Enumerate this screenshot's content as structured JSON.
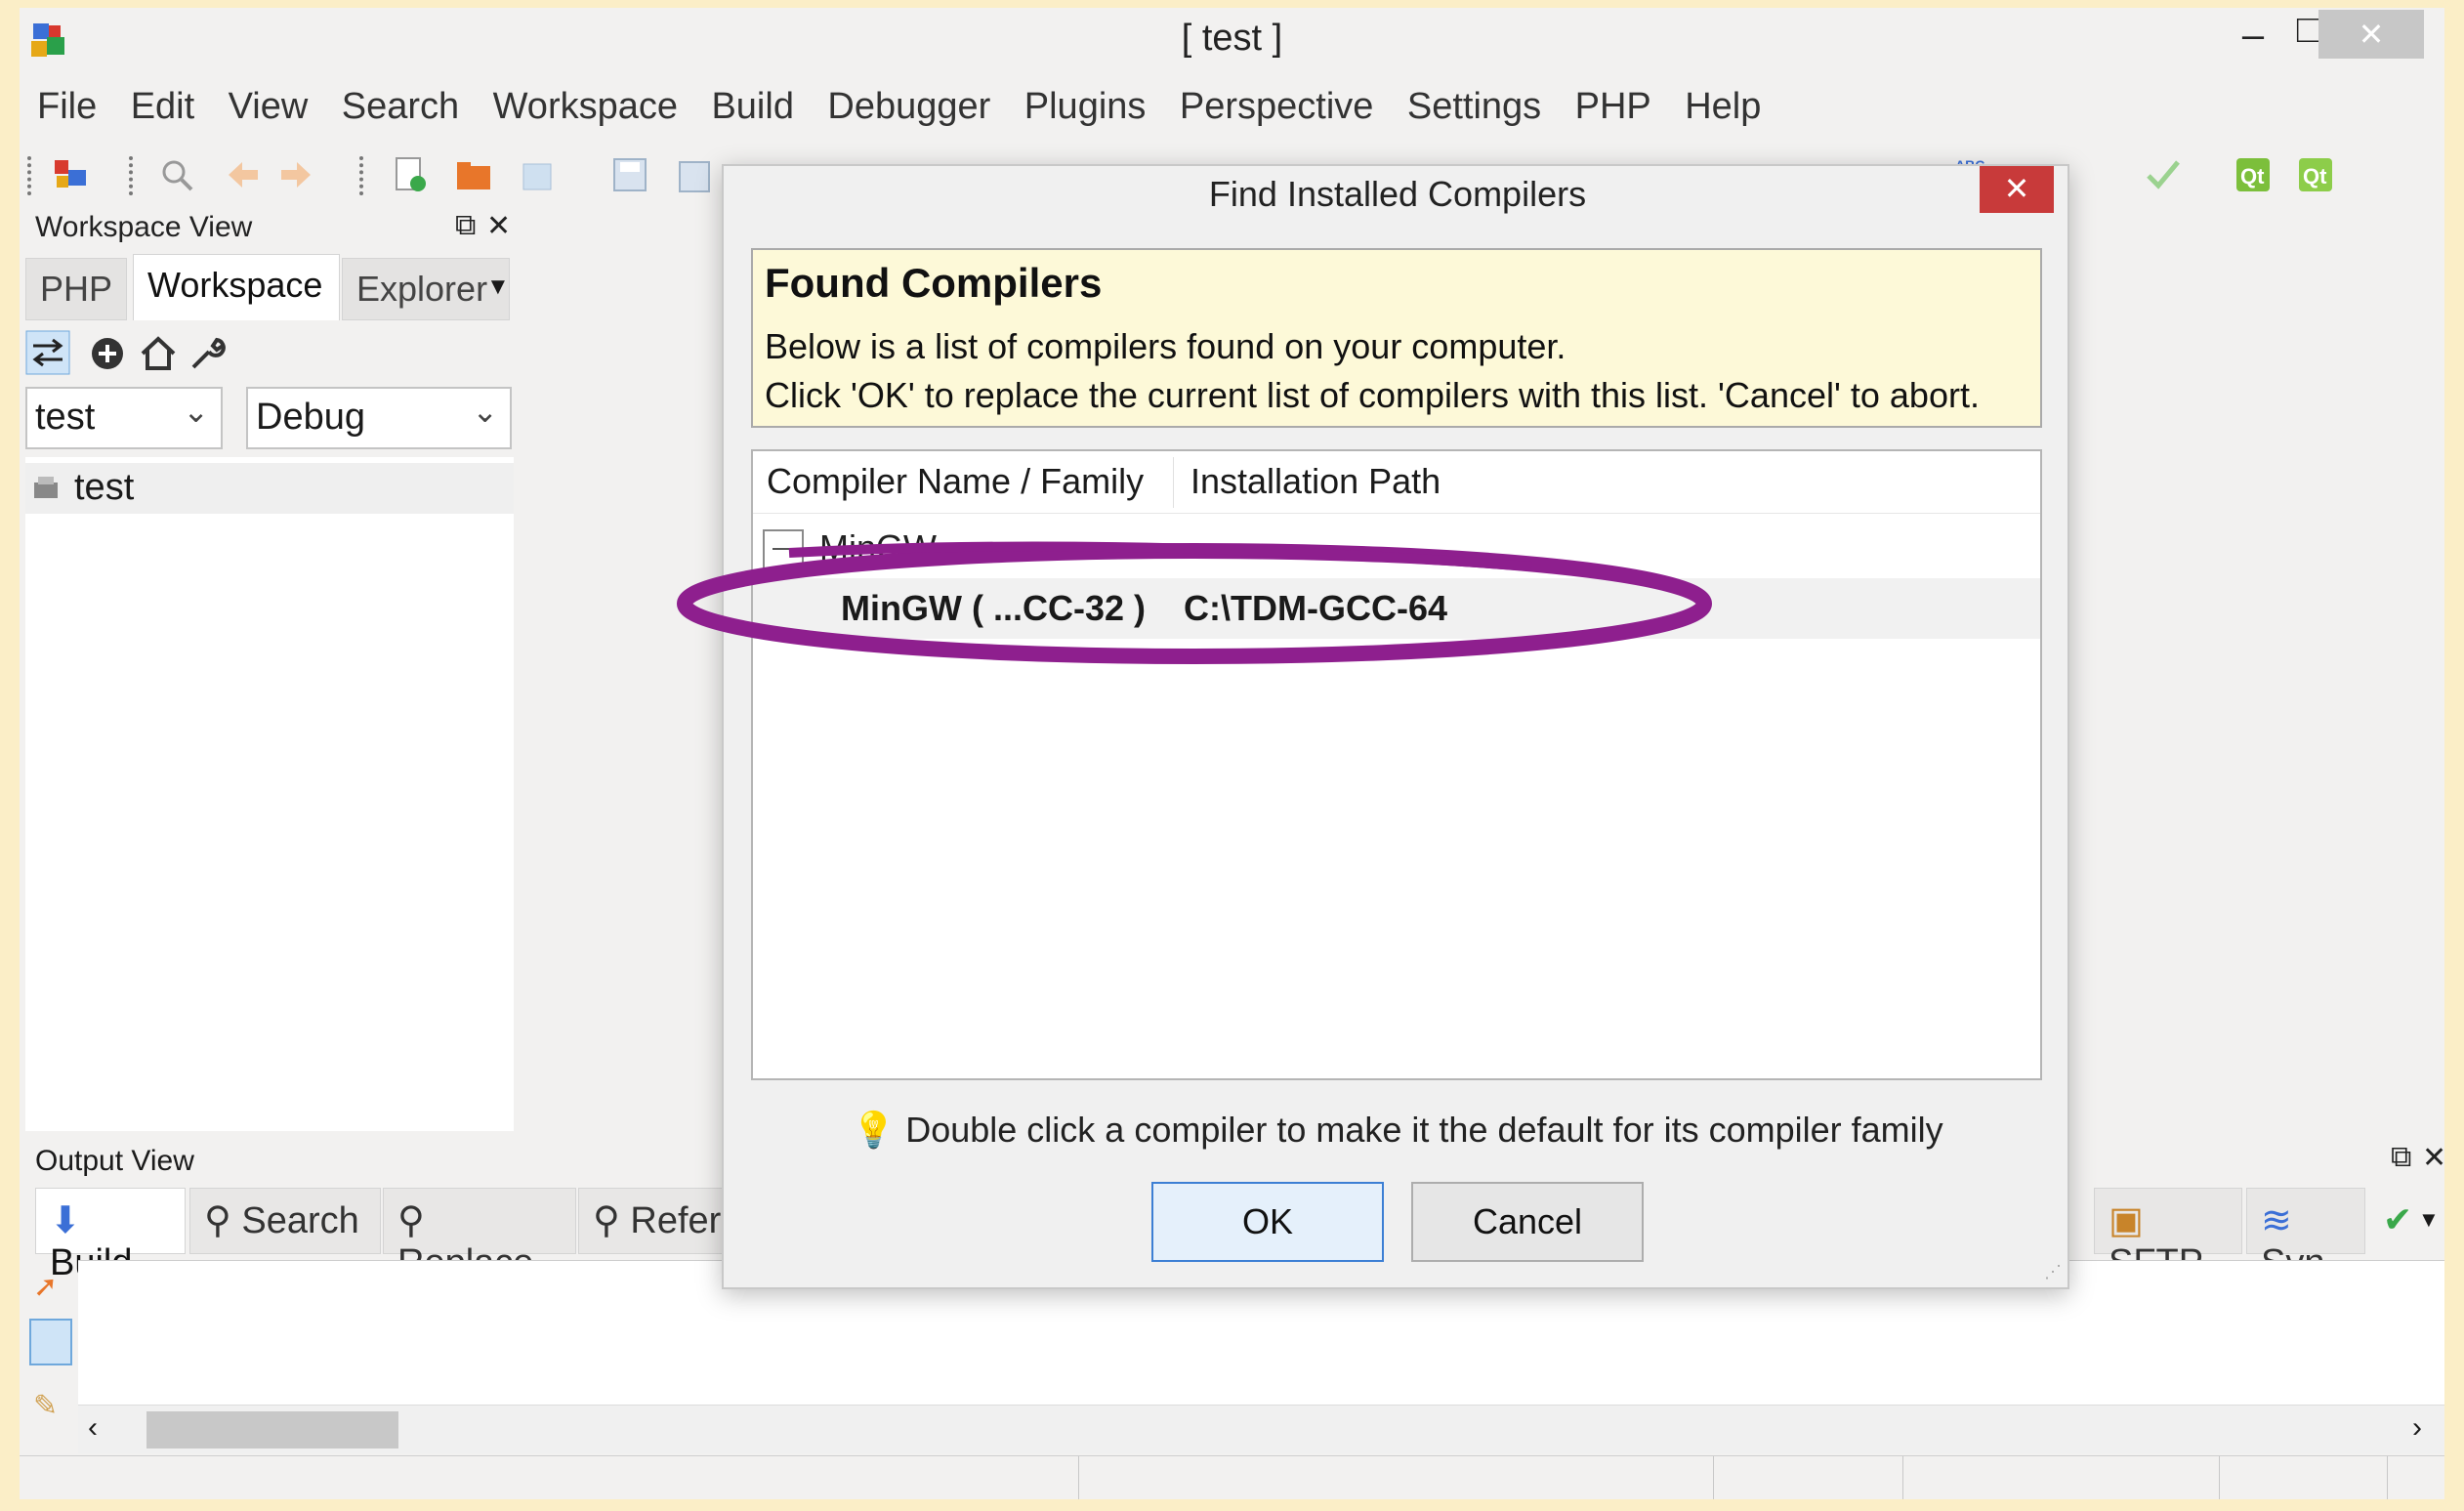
{
  "window": {
    "title": "[ test ]",
    "minimize": "–",
    "maximize": "□",
    "close": "✕"
  },
  "menu": [
    "File",
    "Edit",
    "View",
    "Search",
    "Workspace",
    "Build",
    "Debugger",
    "Plugins",
    "Perspective",
    "Settings",
    "PHP",
    "Help"
  ],
  "workspace_view": {
    "title": "Workspace View",
    "tabs": [
      "PHP",
      "Workspace",
      "Explorer"
    ],
    "active_tab": "Workspace",
    "project_select": "test",
    "config_select": "Debug",
    "tree_item": "test"
  },
  "output_view": {
    "title": "Output View",
    "tabs": [
      "Build",
      "Search",
      "Replace",
      "References"
    ],
    "right_tabs": [
      "SFTP",
      "Svn"
    ]
  },
  "dialog": {
    "title": "Find Installed Compilers",
    "close": "✕",
    "banner_title": "Found Compilers",
    "banner_line1": "Below is a list of compilers found on your computer.",
    "banner_line2": "Click 'OK' to replace the current list of compilers with this list. 'Cancel' to abort.",
    "col_name": "Compiler Name / Family",
    "col_path": "Installation Path",
    "group": "MinGW",
    "compiler_name": "MinGW ( ...CC-32 )",
    "compiler_path": "C:\\TDM-GCC-64",
    "hint": "Double click a compiler to make it the default for its compiler family",
    "ok": "OK",
    "cancel": "Cancel"
  },
  "colors": {
    "highlight": "#8e1f8e",
    "close_red": "#c83a3a",
    "banner": "#fdf9d8"
  }
}
